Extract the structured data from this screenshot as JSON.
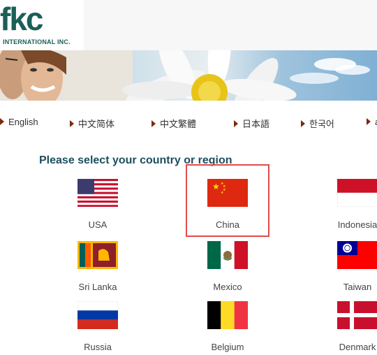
{
  "brand": {
    "logo": "fkc",
    "subtitle": "INTERNATIONAL INC."
  },
  "languages": [
    {
      "label": "English"
    },
    {
      "label": "中文简体"
    },
    {
      "label": "中文繁體"
    },
    {
      "label": "日本語"
    },
    {
      "label": "한국어"
    },
    {
      "label": "a"
    }
  ],
  "page": {
    "title": "Please select your country or region"
  },
  "countries": [
    {
      "name": "USA"
    },
    {
      "name": "China"
    },
    {
      "name": "Indonesia"
    },
    {
      "name": "Sri Lanka"
    },
    {
      "name": "Mexico"
    },
    {
      "name": "Taiwan"
    },
    {
      "name": "Russia"
    },
    {
      "name": "Belgium"
    },
    {
      "name": "Denmark"
    }
  ],
  "colors": {
    "brand": "#1b5f57",
    "title": "#1d4f5f",
    "highlight": "#e24a4a",
    "arrow": "#7a2a0e"
  }
}
